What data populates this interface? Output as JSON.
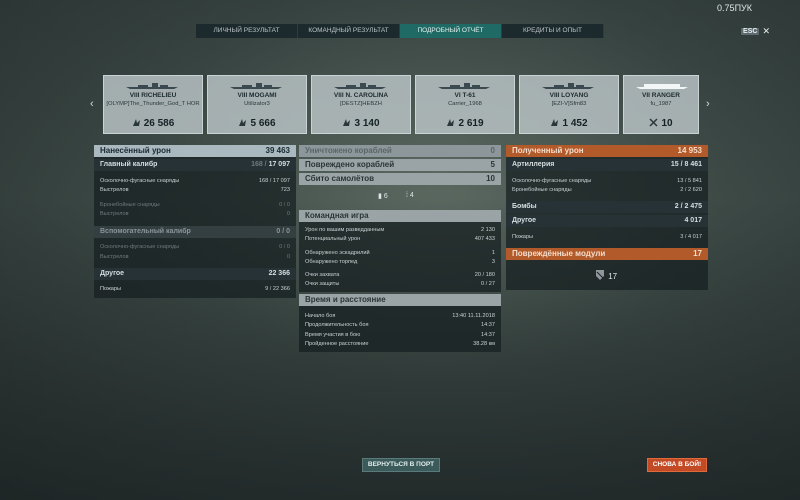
{
  "top": {
    "timestamp": "0.75ПУК",
    "esc_key": "ESC",
    "close": "✕"
  },
  "tabs": [
    "ЛИЧНЫЙ РЕЗУЛЬТАТ",
    "КОМАНДНЫЙ РЕЗУЛЬТАТ",
    "ПОДРОБНЫЙ ОТЧЁТ",
    "КРЕДИТЫ И ОПЫТ"
  ],
  "nav": {
    "prev": "‹",
    "next": "›"
  },
  "ships": [
    {
      "name": "VIII RICHELIEU",
      "player": "[OLYMP]The_Thunder_God_T HOR",
      "value": "26 586",
      "icon": "damage-icon"
    },
    {
      "name": "VIII MOGAMI",
      "player": "Utilizator3",
      "value": "5 666",
      "icon": "damage-icon"
    },
    {
      "name": "VIII N. CAROLINA",
      "player": "[DESTZ]HEBZH",
      "value": "3 140",
      "icon": "damage-icon"
    },
    {
      "name": "VI T-61",
      "player": "Carrier_1968",
      "value": "2 619",
      "icon": "damage-icon"
    },
    {
      "name": "VIII LOYANG",
      "player": "[EZI-V]Sfm83",
      "value": "1 452",
      "icon": "damage-icon"
    },
    {
      "name": "VII RANGER",
      "player": "fu_1987",
      "value": "10",
      "icon": "planes-icon"
    }
  ],
  "left": {
    "header": {
      "label": "Нанесённый урон",
      "value": "39 463"
    },
    "main_caliber": {
      "label": "Главный калибр",
      "value_dim": "168 / ",
      "value": "17 097"
    },
    "he": {
      "label": "Осколочно-фугасные снаряды",
      "value": "168 / 17 097"
    },
    "he_shots": {
      "label": "Выстрелов",
      "value": "723"
    },
    "ap": {
      "label": "Бронебойные снаряды",
      "value": "0 / 0"
    },
    "ap_shots": {
      "label": "Выстрелов",
      "value": "0"
    },
    "secondary": {
      "label": "Вспомогательный калибр",
      "value": "0 / 0"
    },
    "sec_he": {
      "label": "Осколочно-фугасные снаряды",
      "value": "0 / 0"
    },
    "sec_shots": {
      "label": "Выстрелов",
      "value": "0"
    },
    "other": {
      "label": "Другое",
      "value": "22 366"
    },
    "fires": {
      "label": "Пожары",
      "value": "9 / 22 366"
    }
  },
  "middle": {
    "destroyed": {
      "label": "Уничтожено кораблей",
      "value": "0"
    },
    "damaged": {
      "label": "Повреждено кораблей",
      "value": "5"
    },
    "planes": {
      "label": "Сбито самолётов",
      "value": "10"
    },
    "torp_icon_count": "6",
    "plane_icon_count": "4",
    "team": {
      "header": "Командная игра",
      "spotting_damage": {
        "label": "Урон по вашим разведданным",
        "value": "2 130"
      },
      "potential_damage": {
        "label": "Потенциальный урон",
        "value": "407 433"
      },
      "spotted_squadrons": {
        "label": "Обнаружено эскадрилий",
        "value": "1"
      },
      "spotted_torpedoes": {
        "label": "Обнаружено торпед",
        "value": "3"
      },
      "capture": {
        "label": "Очки захвата",
        "value": "20 / 180"
      },
      "defense": {
        "label": "Очки защиты",
        "value": "0 / 27"
      }
    },
    "time": {
      "header": "Время и расстояние",
      "start": {
        "label": "Начало боя",
        "value": "13:40  11.11.2018"
      },
      "duration": {
        "label": "Продолжительность боя",
        "value": "14:37"
      },
      "participation": {
        "label": "Время участия в бою",
        "value": "14:37"
      },
      "distance": {
        "label": "Пройденное расстояние",
        "value": "38.28 км"
      }
    }
  },
  "right": {
    "header": {
      "label": "Полученный урон",
      "value": "14 953"
    },
    "artillery": {
      "label": "Артиллерия",
      "value": "15 / 8 461"
    },
    "he": {
      "label": "Осколочно-фугасные снаряды",
      "value": "13 / 5 841"
    },
    "ap": {
      "label": "Бронебойные снаряды",
      "value": "2 / 2 620"
    },
    "bombs": {
      "label": "Бомбы",
      "value": "2 / 2 475"
    },
    "other": {
      "label": "Другое",
      "value": "4 017"
    },
    "fires": {
      "label": "Пожары",
      "value": "3 / 4 017"
    },
    "modules": {
      "label": "Повреждённые модули",
      "value": "17"
    },
    "module_icon_count": "17"
  },
  "buttons": {
    "port": "ВЕРНУТЬСЯ В ПОРТ",
    "fight": "СНОВА В БОЙ!"
  }
}
